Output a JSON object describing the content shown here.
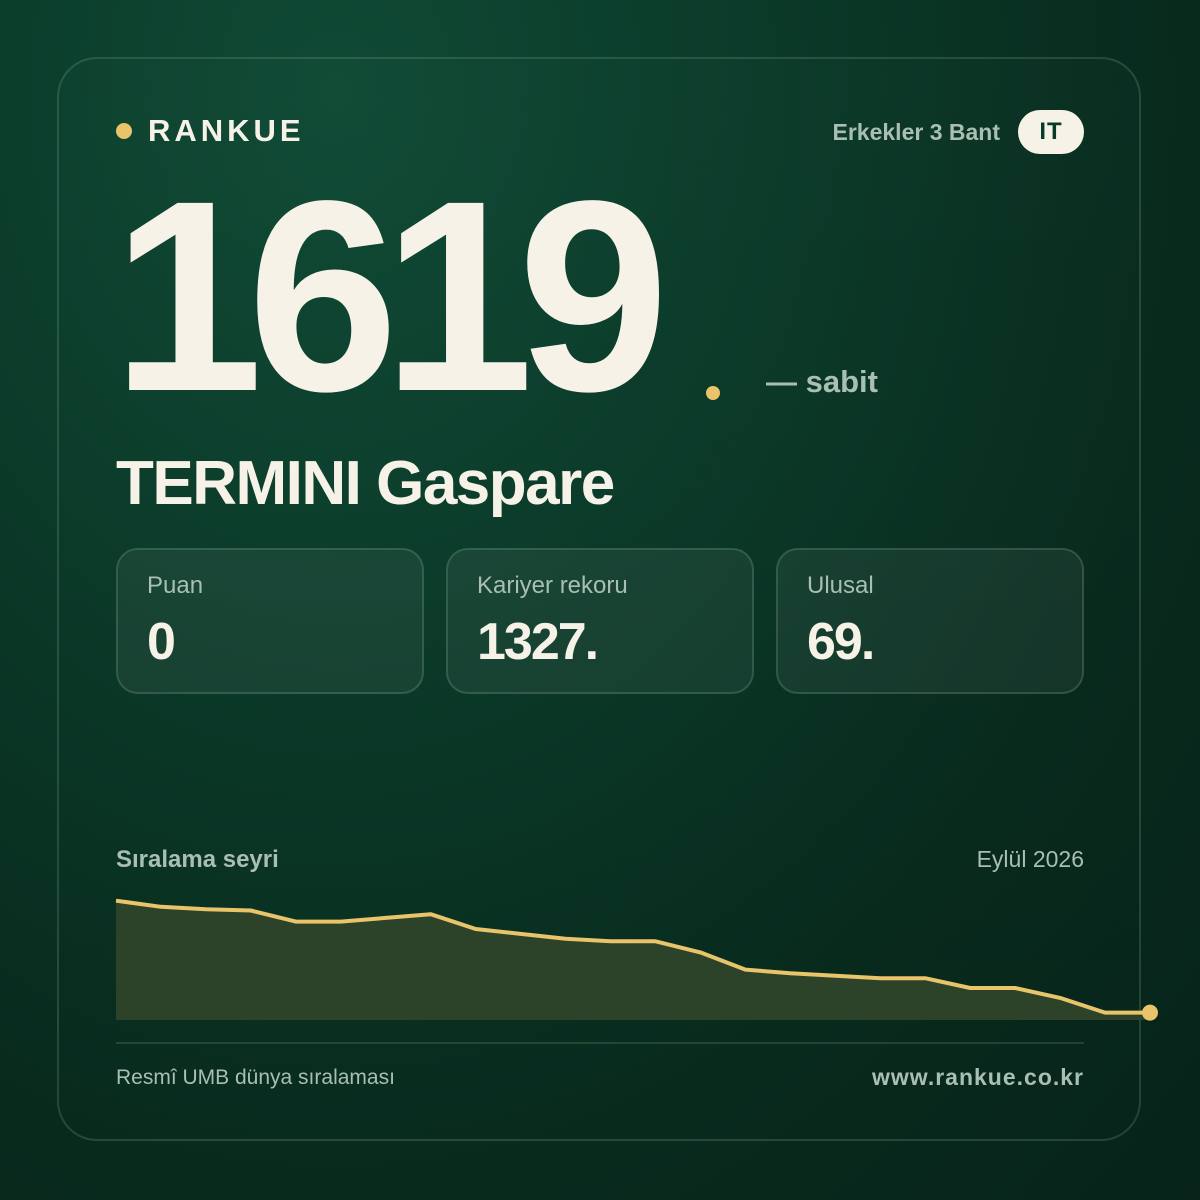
{
  "brand": {
    "name": "RANKUE"
  },
  "header": {
    "category": "Erkekler 3 Bant",
    "country": "IT"
  },
  "ranking": {
    "rank": "1619",
    "trend": "— sabit"
  },
  "player": {
    "name": "TERMINI Gaspare"
  },
  "stats": [
    {
      "label": "Puan",
      "value": "0"
    },
    {
      "label": "Kariyer rekoru",
      "value": "1327."
    },
    {
      "label": "Ulusal",
      "value": "69."
    }
  ],
  "chart": {
    "title": "Sıralama seyri",
    "date": "Eylül 2026"
  },
  "chart_data": {
    "type": "area",
    "x": [
      0,
      1,
      2,
      3,
      4,
      5,
      6,
      7,
      8,
      9,
      10,
      11,
      12,
      13,
      14,
      15,
      16,
      17,
      18,
      19,
      20,
      21,
      22,
      23
    ],
    "series": [
      {
        "values": [
          0.97,
          0.92,
          0.9,
          0.89,
          0.8,
          0.8,
          0.83,
          0.86,
          0.74,
          0.7,
          0.66,
          0.64,
          0.64,
          0.55,
          0.41,
          0.38,
          0.36,
          0.34,
          0.34,
          0.26,
          0.26,
          0.18,
          0.06,
          0.06
        ]
      }
    ],
    "ylim": [
      0,
      1
    ],
    "grid": false
  },
  "footer": {
    "source": "Resmî UMB dünya sıralaması",
    "url": "www.rankue.co.kr"
  },
  "colors": {
    "background": "#0b3a29",
    "text": "#f6f2e8",
    "muted": "#a9bfb1",
    "accent": "#e9c46a",
    "area_fill": "#2c4329"
  }
}
